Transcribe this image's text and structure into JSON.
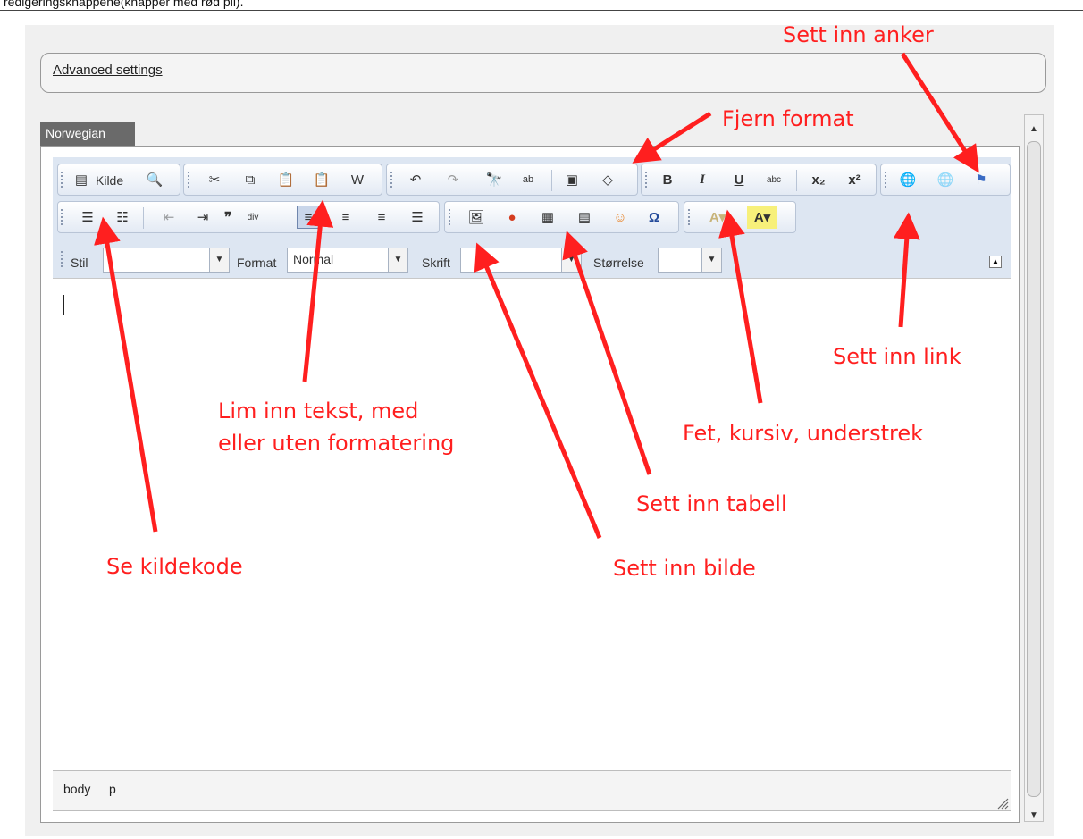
{
  "page": {
    "top_text": "redigeringsknappene(knapper med rød pil).",
    "advanced_settings": "Advanced settings",
    "language_tab": "Norwegian"
  },
  "toolbar": {
    "source_label": "Kilde",
    "row3": {
      "style_label": "Stil",
      "format_label": "Format",
      "format_value": "Normal",
      "font_label": "Skrift",
      "size_label": "Størrelse"
    }
  },
  "statusbar": {
    "path": [
      "body",
      "p"
    ]
  },
  "annotations": {
    "sett_inn_anker": "Sett inn anker",
    "fjern_format": "Fjern format",
    "sett_inn_link": "Sett inn link",
    "lim_inn_1": "Lim inn tekst, med",
    "lim_inn_2": "eller uten formatering",
    "fet_kursiv": "Fet, kursiv, understrek",
    "sett_inn_tabell": "Sett inn tabell",
    "se_kildekode": "Se kildekode",
    "sett_inn_bilde": "Sett inn bilde"
  },
  "icons": [
    "source-icon",
    "preview-icon",
    "cut-icon",
    "copy-icon",
    "paste-icon",
    "paste-text-icon",
    "paste-word-icon",
    "undo-icon",
    "redo-icon",
    "find-icon",
    "replace-icon",
    "select-all-icon",
    "remove-format-icon",
    "bold-icon",
    "italic-icon",
    "underline-icon",
    "strike-icon",
    "subscript-icon",
    "superscript-icon",
    "link-icon",
    "unlink-icon",
    "anchor-icon",
    "numbered-list-icon",
    "bulleted-list-icon",
    "outdent-icon",
    "indent-icon",
    "blockquote-icon",
    "div-icon",
    "align-left-icon",
    "align-center-icon",
    "align-right-icon",
    "justify-icon",
    "image-icon",
    "flash-icon",
    "table-icon",
    "horizontal-rule-icon",
    "smiley-icon",
    "special-char-icon",
    "text-color-icon",
    "bg-color-icon"
  ],
  "colors": {
    "annotation": "#ff1f1f",
    "toolbar_bg": "#dde6f2",
    "tab_bg": "#6a6a6a"
  }
}
